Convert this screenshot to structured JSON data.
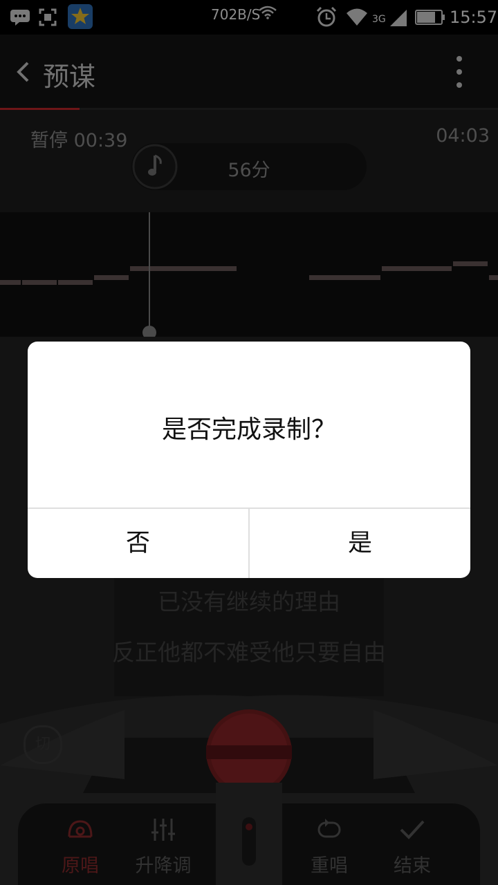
{
  "status_bar": {
    "network_speed": "702B/S",
    "network_type": "3G",
    "time": "15:57",
    "icons": [
      "message-icon",
      "screenshot-icon",
      "app-star-icon",
      "wifi-icon",
      "alarm-icon",
      "signal-icon",
      "battery-icon"
    ]
  },
  "header": {
    "title": "预谋",
    "back_icon": "chevron-left-icon",
    "menu_icon": "more-vertical-icon"
  },
  "progress": {
    "fraction": 0.16
  },
  "player": {
    "status_time": "暂停 00:39",
    "total_time": "04:03",
    "score": "56分"
  },
  "lyrics": {
    "line1": "已没有继续的理由",
    "line2": "反正他都不难受他只要自由"
  },
  "switch_button": {
    "label": "切"
  },
  "bottom_bar": {
    "items": [
      {
        "label": "原唱",
        "icon": "original-vocal-icon",
        "active": true
      },
      {
        "label": "升降调",
        "icon": "pitch-adjust-icon",
        "active": false
      },
      {
        "label": "重唱",
        "icon": "repeat-icon",
        "active": false
      },
      {
        "label": "结束",
        "icon": "check-icon",
        "active": false
      }
    ]
  },
  "dialog": {
    "message": "是否完成录制？",
    "no_label": "否",
    "yes_label": "是"
  },
  "colors": {
    "accent": "#c8282d",
    "dialog_bg": "#ffffff",
    "text_dark": "#111111"
  }
}
